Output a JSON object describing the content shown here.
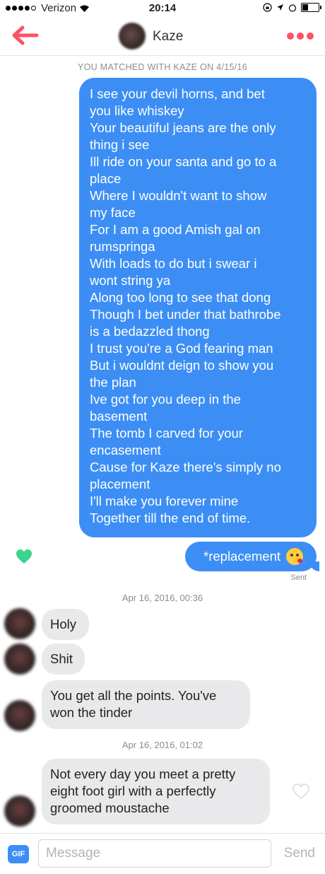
{
  "status_bar": {
    "carrier": "Verizon",
    "time": "20:14"
  },
  "header": {
    "contact_name": "Kaze"
  },
  "matched_banner": "YOU MATCHED WITH KAZE ON 4/15/16",
  "messages_out": {
    "poem_lines": [
      "I see your devil horns, and bet",
      "you like whiskey",
      "Your beautiful jeans are the only",
      "thing i see",
      "Ill ride on your santa and go to a",
      "place",
      "Where I wouldn't want to show",
      "my face",
      "For I am a good Amish gal on",
      "rumspringa",
      "With loads to do but i swear i",
      "wont string ya",
      "Along too long to see that dong",
      "Though I bet under that bathrobe",
      "is a bedazzled thong",
      "I trust you're a God fearing man",
      "But i wouldnt deign to show you",
      "the plan",
      "Ive got for you deep in the",
      "basement",
      "The tomb I carved for your",
      "encasement",
      "Cause for Kaze there's simply no",
      "placement",
      "I'll make you forever mine",
      "Together till the end of time."
    ],
    "correction": "*replacement",
    "correction_emoji": "kiss-wink-emoji",
    "status": "Sent"
  },
  "timestamps": [
    "Apr 16, 2016, 00:36",
    "Apr 16, 2016, 01:02"
  ],
  "messages_in": [
    {
      "text": "Holy"
    },
    {
      "text": "Shit"
    },
    {
      "lines": [
        "You get all the points. You've",
        "won the tinder"
      ]
    },
    {
      "lines": [
        "Not every day you meet a pretty",
        "eight foot girl with a perfectly",
        "groomed moustache"
      ]
    }
  ],
  "composer": {
    "gif_label": "GIF",
    "placeholder": "Message",
    "send_label": "Send"
  },
  "colors": {
    "accent_red": "#fe5267",
    "bubble_blue": "#3c8ef5",
    "like_green": "#3dd38f",
    "bubble_gray": "#e9e9eb"
  }
}
